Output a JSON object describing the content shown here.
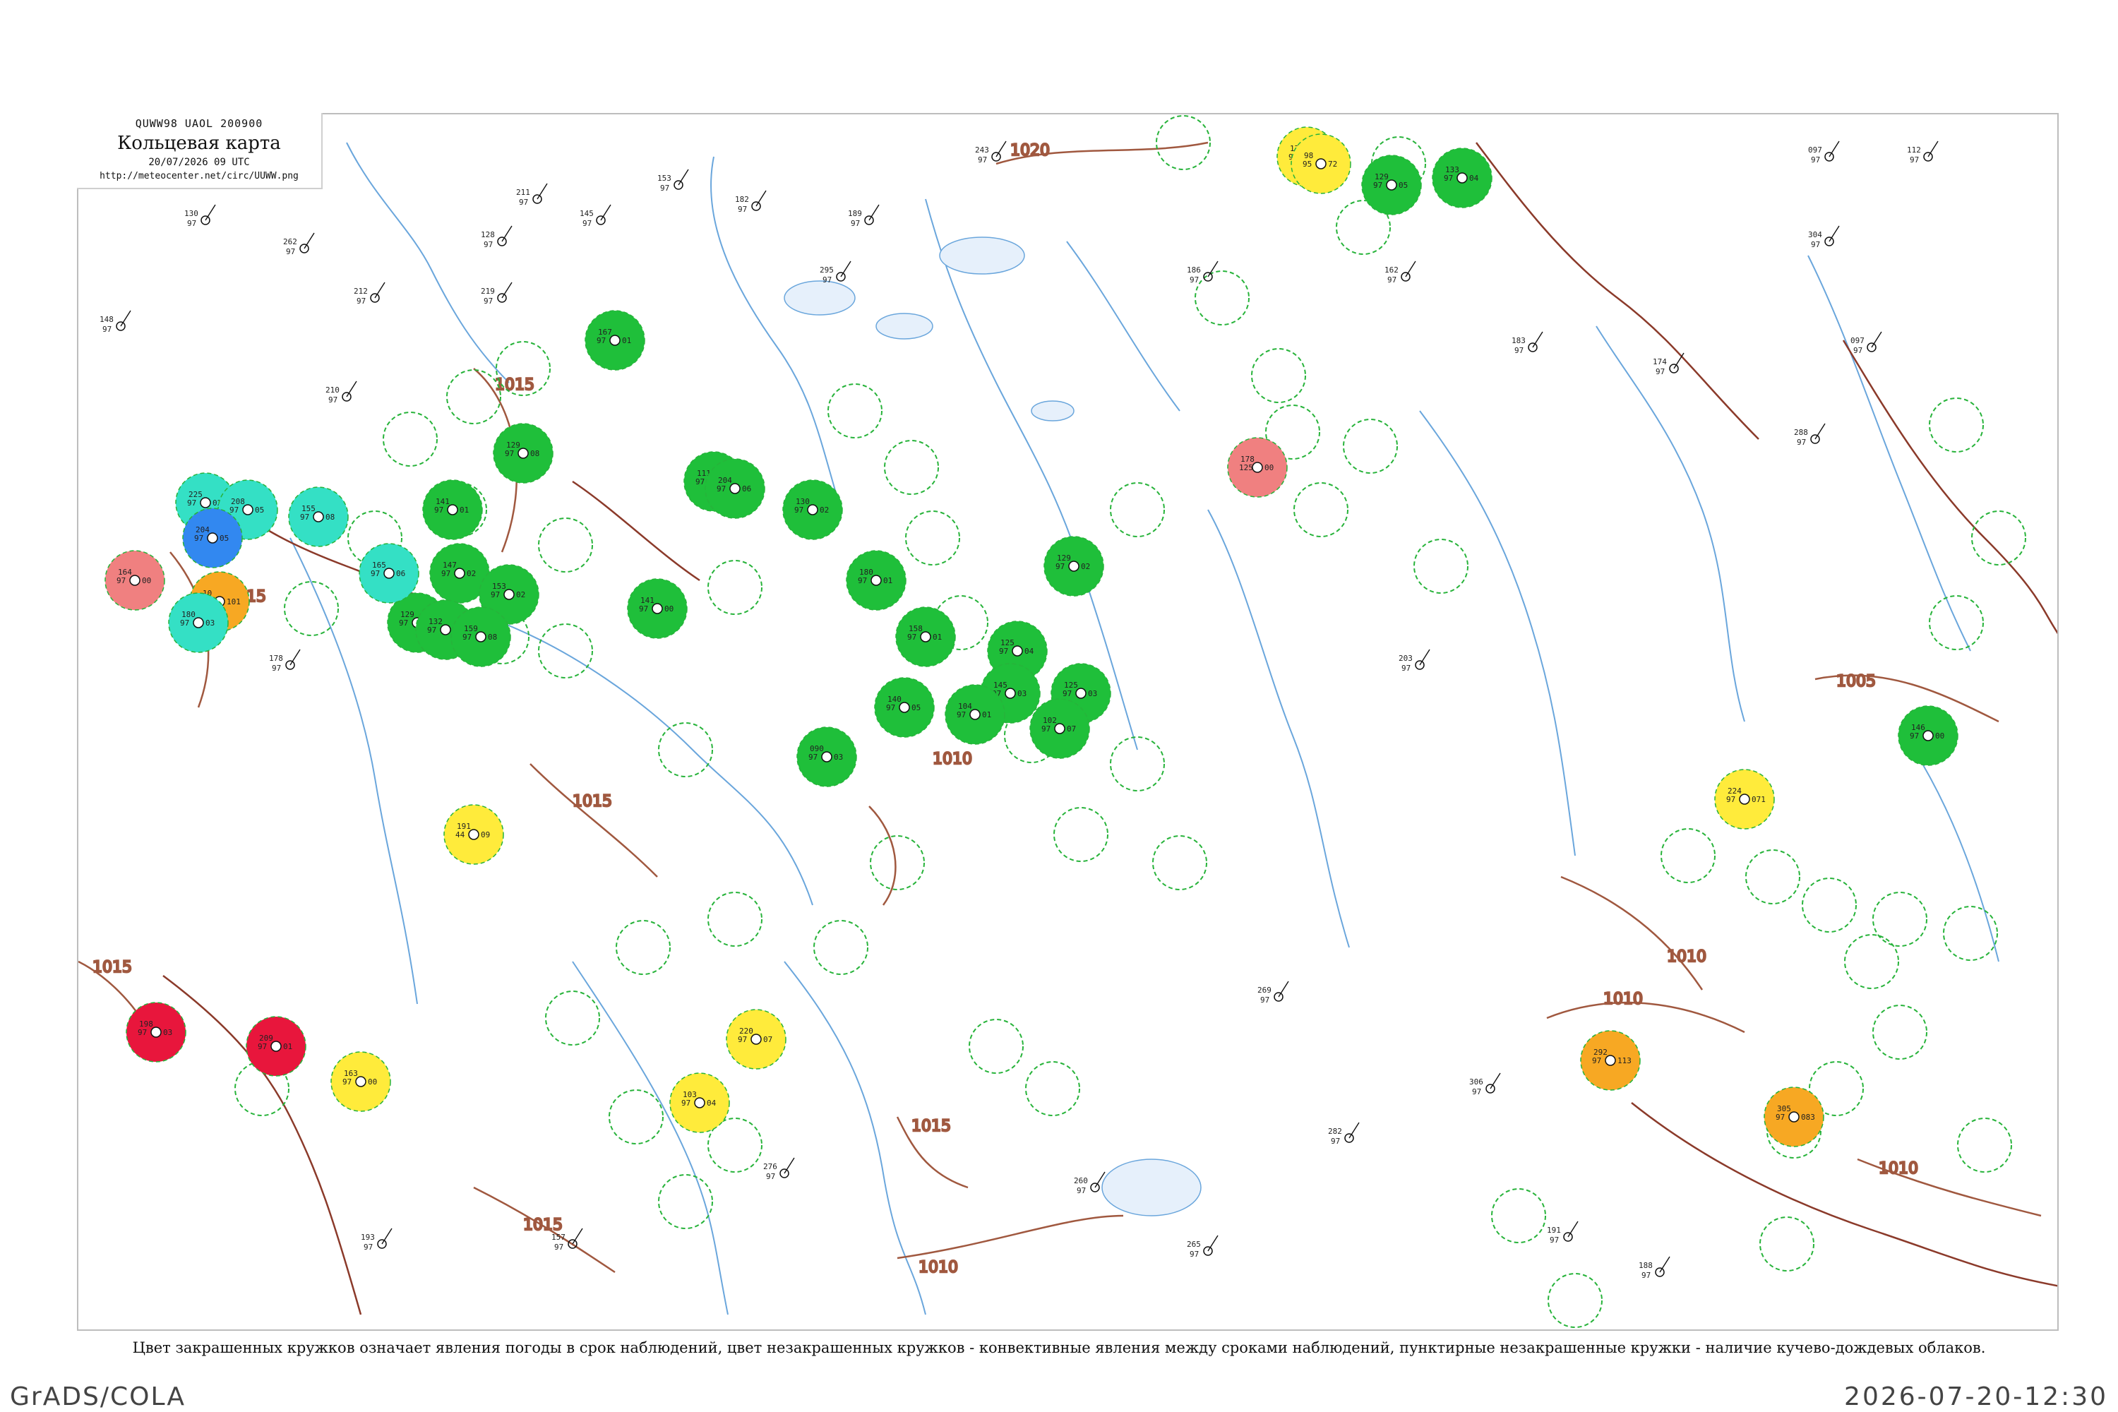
{
  "header": {
    "code": "QUWW98  UAOL  200900",
    "title": "Кольцевая карта",
    "datetime": "20/07/2026 09 UTC",
    "url": "http://meteocenter.net/circ/UUWW.png"
  },
  "caption": "Цвет закрашенных кружков означает явления погоды в срок наблюдений, цвет незакрашенных кружков - конвективные явления между сроками наблюдений, пунктирные незакрашенные кружки - наличие кучево-дождевых облаков.",
  "footer": {
    "left": "GrADS/COLA",
    "right": "2026-07-20-12:30"
  },
  "colors": {
    "rain": "#1fbf3a",
    "shower": "#ffeb3b",
    "fog": "#f7a823",
    "thunder": "#e8163c",
    "drizzle": "#34e0c5",
    "snow": "#3288f0",
    "haze": "#f08080",
    "cb_dashed": "#27b33a",
    "isobar": "#a0583f",
    "river": "#6aa6dc",
    "border": "#8b3a2a"
  },
  "isobars": [
    "1020",
    "1015",
    "1015",
    "1015",
    "1010",
    "1015",
    "1010",
    "1010",
    "1010",
    "1005",
    "1010",
    "1015",
    "1015"
  ],
  "stations": [
    {
      "type": "rain",
      "a": "167",
      "b": "97",
      "c": "01"
    },
    {
      "type": "rain",
      "a": "129",
      "b": "97",
      "c": "08"
    },
    {
      "type": "rain",
      "a": "141",
      "b": "97",
      "c": "01"
    },
    {
      "type": "rain",
      "a": "147",
      "b": "97",
      "c": "02"
    },
    {
      "type": "rain",
      "a": "153",
      "b": "97",
      "c": "02"
    },
    {
      "type": "rain",
      "a": "129",
      "b": "97",
      "c": "01"
    },
    {
      "type": "rain",
      "a": "132",
      "b": "97",
      "c": "04"
    },
    {
      "type": "rain",
      "a": "159",
      "b": "97",
      "c": "08"
    },
    {
      "type": "rain",
      "a": "141",
      "b": "97",
      "c": "00"
    },
    {
      "type": "rain",
      "a": "130",
      "b": "97",
      "c": "02"
    },
    {
      "type": "rain",
      "a": "111",
      "b": "97",
      "c": "03"
    },
    {
      "type": "rain",
      "a": "204",
      "b": "97",
      "c": "06"
    },
    {
      "type": "rain",
      "a": "180",
      "b": "97",
      "c": "01"
    },
    {
      "type": "rain",
      "a": "158",
      "b": "97",
      "c": "01"
    },
    {
      "type": "rain",
      "a": "125",
      "b": "97",
      "c": "04"
    },
    {
      "type": "rain",
      "a": "129",
      "b": "97",
      "c": "02"
    },
    {
      "type": "rain",
      "a": "125",
      "b": "97",
      "c": "03"
    },
    {
      "type": "rain",
      "a": "145",
      "b": "97",
      "c": "03"
    },
    {
      "type": "rain",
      "a": "104",
      "b": "97",
      "c": "01"
    },
    {
      "type": "rain",
      "a": "140",
      "b": "97",
      "c": "05"
    },
    {
      "type": "rain",
      "a": "090",
      "b": "97",
      "c": "03"
    },
    {
      "type": "rain",
      "a": "102",
      "b": "97",
      "c": "07"
    },
    {
      "type": "rain",
      "a": "129",
      "b": "97",
      "c": "05"
    },
    {
      "type": "rain",
      "a": "133",
      "b": "97",
      "c": "04"
    },
    {
      "type": "rain",
      "a": "146",
      "b": "97",
      "c": "00"
    },
    {
      "type": "shower",
      "a": "177",
      "b": "95",
      "c": "11"
    },
    {
      "type": "shower",
      "a": "191",
      "b": "44",
      "c": "09"
    },
    {
      "type": "shower",
      "a": "220",
      "b": "97",
      "c": "07"
    },
    {
      "type": "shower",
      "a": "103",
      "b": "97",
      "c": "04"
    },
    {
      "type": "shower",
      "a": "163",
      "b": "97",
      "c": "00"
    },
    {
      "type": "shower",
      "a": "224",
      "b": "97",
      "c": "071"
    },
    {
      "type": "shower",
      "a": "98",
      "b": "95",
      "c": "72"
    },
    {
      "type": "fog",
      "a": "292",
      "b": "97",
      "c": "113"
    },
    {
      "type": "fog",
      "a": "305",
      "b": "97",
      "c": "083"
    },
    {
      "type": "fog",
      "a": "10",
      "b": "97",
      "c": "101"
    },
    {
      "type": "thunder",
      "a": "198",
      "b": "97",
      "c": "03"
    },
    {
      "type": "thunder",
      "a": "209",
      "b": "97",
      "c": "01"
    },
    {
      "type": "drizzle",
      "a": "225",
      "b": "97",
      "c": "02"
    },
    {
      "type": "drizzle",
      "a": "208",
      "b": "97",
      "c": "05"
    },
    {
      "type": "drizzle",
      "a": "155",
      "b": "97",
      "c": "08"
    },
    {
      "type": "drizzle",
      "a": "165",
      "b": "97",
      "c": "06"
    },
    {
      "type": "drizzle",
      "a": "180",
      "b": "97",
      "c": "03"
    },
    {
      "type": "snow",
      "a": "204",
      "b": "97",
      "c": "05"
    },
    {
      "type": "haze",
      "a": "164",
      "b": "97",
      "c": "00"
    },
    {
      "type": "haze",
      "a": "178",
      "b": "125",
      "c": "00"
    }
  ],
  "plain_labels": [
    "148",
    "243",
    "097",
    "112",
    "189",
    "304",
    "097",
    "288",
    "130",
    "295",
    "262",
    "128",
    "211",
    "145",
    "153",
    "182",
    "212",
    "219",
    "186",
    "162",
    "183",
    "174",
    "210",
    "178",
    "203",
    "191",
    "188",
    "260",
    "265",
    "276",
    "157",
    "193",
    "282",
    "306",
    "269"
  ]
}
